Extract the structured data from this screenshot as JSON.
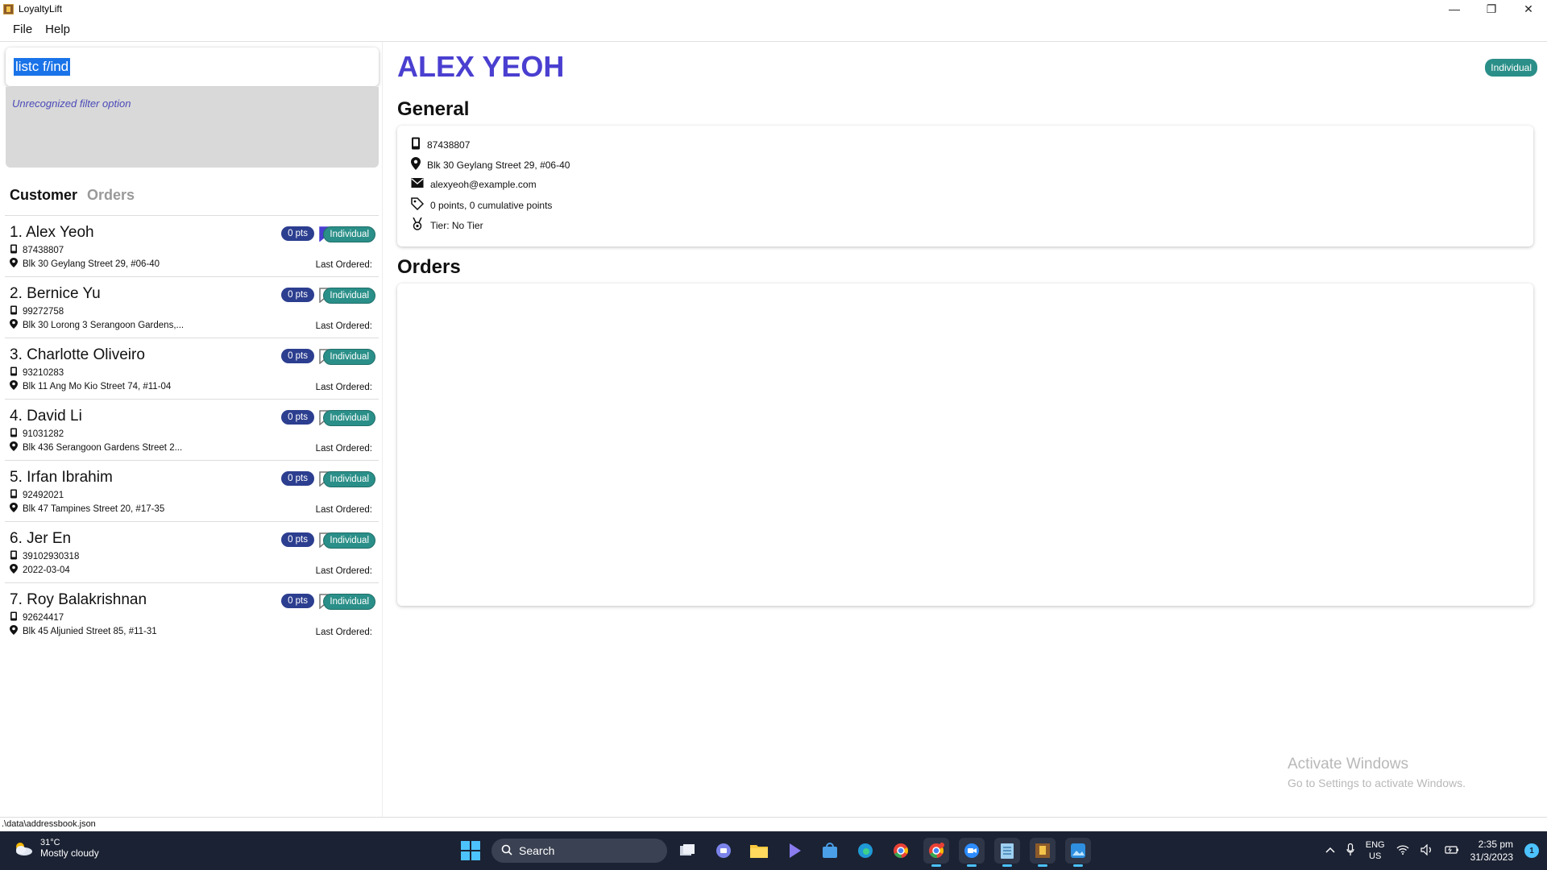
{
  "window": {
    "title": "LoyaltyLift",
    "minimize": "—",
    "restore": "❐",
    "close": "✕"
  },
  "menu": {
    "items": [
      "File",
      "Help"
    ]
  },
  "command": {
    "value": "listc f/ind",
    "result": "Unrecognized filter option"
  },
  "tabs": {
    "customer": "Customer",
    "orders": "Orders"
  },
  "customers": [
    {
      "index": "1.",
      "name": "Alex Yeoh",
      "phone": "87438807",
      "address": "Blk 30 Geylang Street 29, #06-40",
      "points": "0 pts",
      "type": "Individual",
      "bookmarked": true,
      "last_ordered": "Last Ordered:"
    },
    {
      "index": "2.",
      "name": "Bernice Yu",
      "phone": "99272758",
      "address": "Blk 30 Lorong 3 Serangoon Gardens,...",
      "points": "0 pts",
      "type": "Individual",
      "bookmarked": false,
      "last_ordered": "Last Ordered:"
    },
    {
      "index": "3.",
      "name": "Charlotte Oliveiro",
      "phone": "93210283",
      "address": "Blk 11 Ang Mo Kio Street 74, #11-04",
      "points": "0 pts",
      "type": "Individual",
      "bookmarked": false,
      "last_ordered": "Last Ordered:"
    },
    {
      "index": "4.",
      "name": "David Li",
      "phone": "91031282",
      "address": "Blk 436 Serangoon Gardens Street 2...",
      "points": "0 pts",
      "type": "Individual",
      "bookmarked": false,
      "last_ordered": "Last Ordered:"
    },
    {
      "index": "5.",
      "name": "Irfan Ibrahim",
      "phone": "92492021",
      "address": "Blk 47 Tampines Street 20, #17-35",
      "points": "0 pts",
      "type": "Individual",
      "bookmarked": false,
      "last_ordered": "Last Ordered:"
    },
    {
      "index": "6.",
      "name": "Jer En",
      "phone": "39102930318",
      "address": "2022-03-04",
      "points": "0 pts",
      "type": "Individual",
      "bookmarked": false,
      "last_ordered": "Last Ordered:"
    },
    {
      "index": "7.",
      "name": "Roy Balakrishnan",
      "phone": "92624417",
      "address": "Blk 45 Aljunied Street 85, #11-31",
      "points": "0 pts",
      "type": "Individual",
      "bookmarked": false,
      "last_ordered": "Last Ordered:"
    }
  ],
  "detail": {
    "name": "ALEX YEOH",
    "type": "Individual",
    "general_title": "General",
    "phone": "87438807",
    "address": "Blk 30 Geylang Street 29, #06-40",
    "email": "alexyeoh@example.com",
    "points": "0 points, 0 cumulative points",
    "tier": "Tier: No Tier",
    "orders_title": "Orders"
  },
  "status": {
    "path": ".\\data\\addressbook.json"
  },
  "watermark": {
    "line1": "Activate Windows",
    "line2": "Go to Settings to activate Windows."
  },
  "taskbar": {
    "temp": "31°C",
    "condition": "Mostly cloudy",
    "search": "Search",
    "lang1": "ENG",
    "lang2": "US",
    "time": "2:35 pm",
    "date": "31/3/2023",
    "notifications": "1"
  },
  "colors": {
    "accent": "#4a3fd0",
    "badge_points": "#2c3e8f",
    "badge_type": "#2a8f88",
    "taskbar": "#1b2233"
  }
}
